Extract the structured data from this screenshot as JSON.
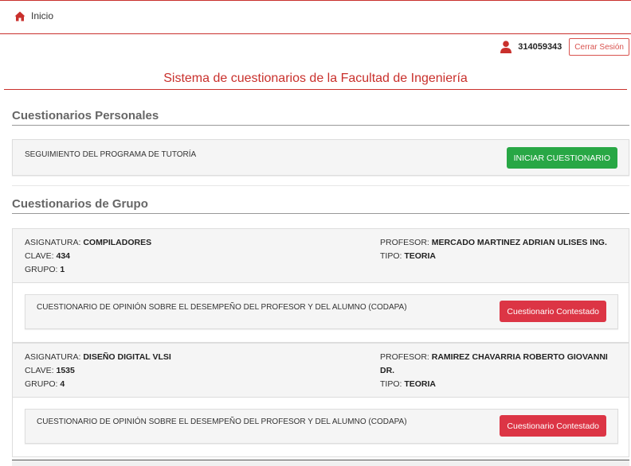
{
  "nav": {
    "home_label": "Inicio",
    "home_icon": "home-icon"
  },
  "user": {
    "id": "314059343",
    "logout_label": "Cerrar Sesión",
    "icon": "user-icon"
  },
  "system_title": "Sistema de cuestionarios de la Facultad de Ingeniería",
  "personal": {
    "heading": "Cuestionarios Personales",
    "items": [
      {
        "label": "SEGUIMIENTO DEL PROGRAMA DE TUTORÍA",
        "button": "INICIAR CUESTIONARIO"
      }
    ]
  },
  "group": {
    "heading": "Cuestionarios de Grupo",
    "labels": {
      "asignatura": "ASIGNATURA:",
      "clave": "CLAVE:",
      "grupo": "GRUPO:",
      "profesor": "PROFESOR:",
      "tipo": "TIPO:"
    },
    "items": [
      {
        "asignatura": "COMPILADORES",
        "clave": "434",
        "grupo": "1",
        "profesor": "MERCADO MARTINEZ ADRIAN ULISES ING.",
        "tipo": "TEORIA",
        "questionnaire": "CUESTIONARIO DE OPINIÓN SOBRE EL DESEMPEÑO DEL PROFESOR Y DEL ALUMNO (CODAPA)",
        "button": "Cuestionario Contestado"
      },
      {
        "asignatura": "DISEÑO DIGITAL VLSI",
        "clave": "1535",
        "grupo": "4",
        "profesor": "RAMIREZ CHAVARRIA ROBERTO GIOVANNI DR.",
        "tipo": "TEORIA",
        "questionnaire": "CUESTIONARIO DE OPINIÓN SOBRE EL DESEMPEÑO DEL PROFESOR Y DEL ALUMNO (CODAPA)",
        "button": "Cuestionario Contestado"
      }
    ]
  },
  "colors": {
    "brand_red": "#c9302c",
    "success": "#28a745",
    "danger": "#dc3545"
  }
}
